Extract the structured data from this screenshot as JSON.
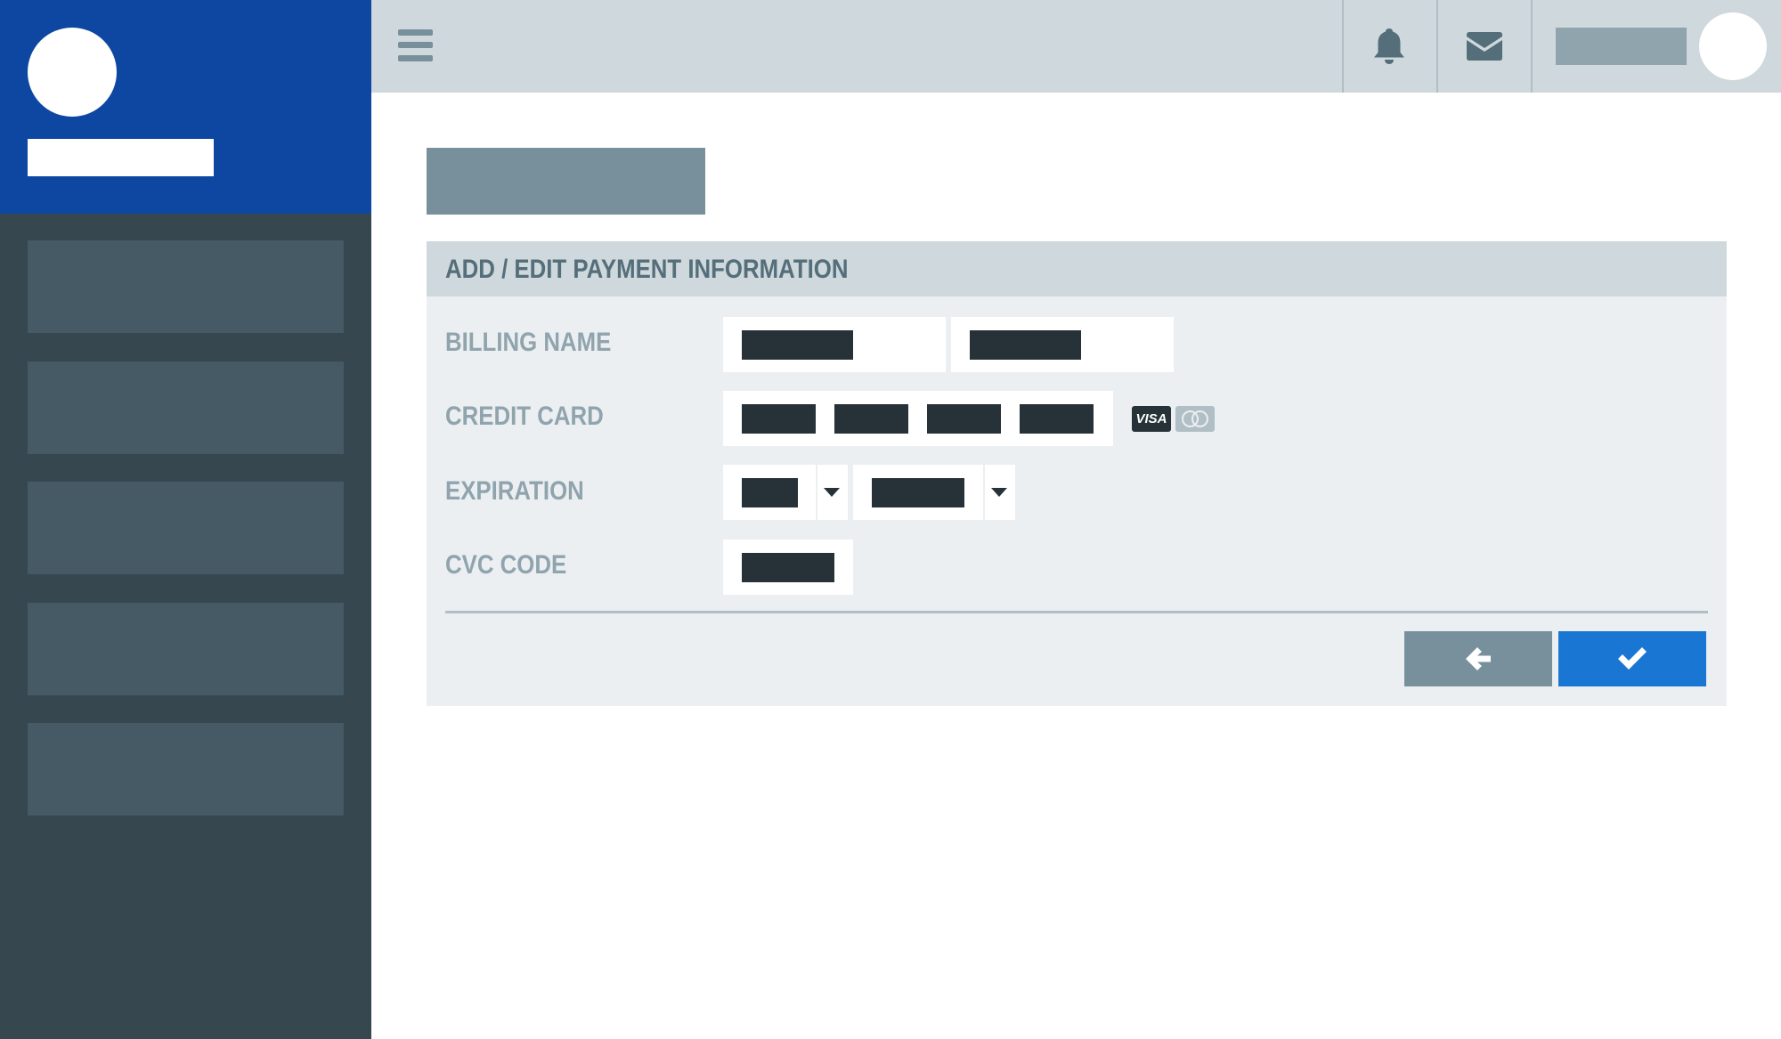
{
  "app": {
    "accent_color": "#0d47a1",
    "sidebar_color": "#37474f",
    "primary_button_color": "#1976d2"
  },
  "sidebar": {
    "items": [
      {
        "icon": "placeholder"
      },
      {
        "icon": "placeholder"
      },
      {
        "icon": "placeholder"
      },
      {
        "icon": "placeholder"
      },
      {
        "icon": "placeholder"
      }
    ]
  },
  "topbar": {
    "icons": [
      "menu-icon",
      "bell-icon",
      "mail-icon"
    ]
  },
  "form": {
    "title": "ADD / EDIT PAYMENT INFORMATION",
    "labels": {
      "billing_name": "BILLING NAME",
      "credit_card": "CREDIT CARD",
      "expiration": "EXPIRATION",
      "cvc": "CVC CODE"
    },
    "card_brands": [
      "VISA",
      "mastercard"
    ],
    "buttons": {
      "back_icon": "arrow-left-icon",
      "confirm_icon": "check-icon"
    }
  }
}
